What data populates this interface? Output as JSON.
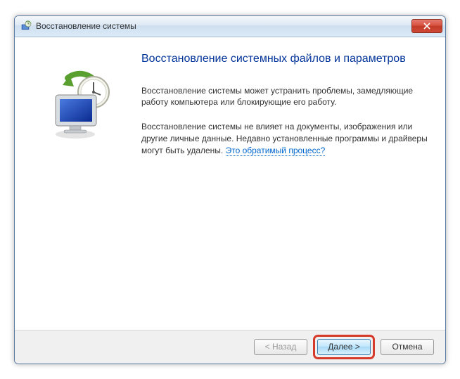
{
  "titlebar": {
    "title": "Восстановление системы"
  },
  "content": {
    "heading": "Восстановление системных файлов и параметров",
    "para1": "Восстановление системы может устранить проблемы, замедляющие работу компьютера или блокирующие его работу.",
    "para2_a": "Восстановление системы не влияет на документы, изображения или другие личные данные. Недавно установленные программы и драйверы могут быть удалены. ",
    "link_text": "Это обратимый процесс?"
  },
  "buttons": {
    "back": "< Назад",
    "next": "Далее >",
    "cancel": "Отмена"
  }
}
